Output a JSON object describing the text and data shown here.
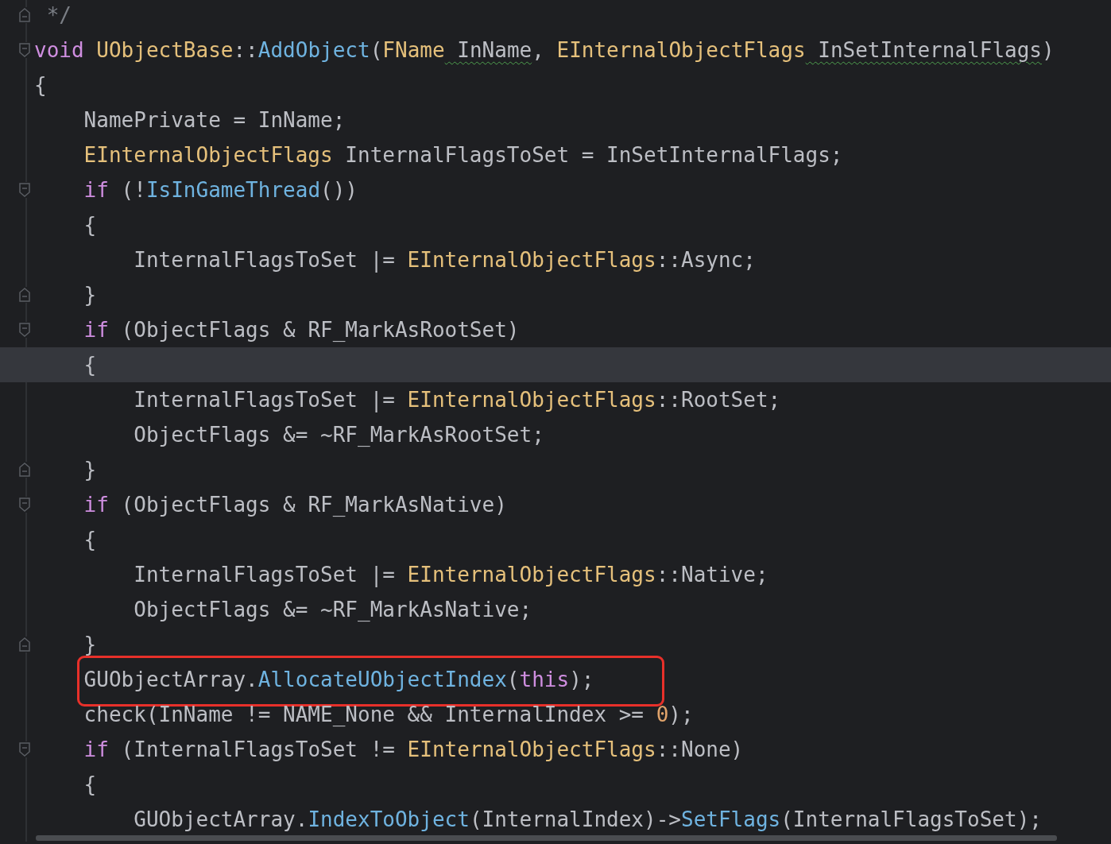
{
  "editor": {
    "lines": [
      {
        "kind": "fold_end",
        "current": false,
        "boxed": false,
        "tokens": [
          {
            "text": " */",
            "kind": "comment"
          }
        ]
      },
      {
        "kind": "fold_start",
        "current": false,
        "boxed": false,
        "tokens": [
          {
            "text": "void",
            "kind": "keyword"
          },
          {
            "text": " UObjectBase",
            "kind": "type"
          },
          {
            "text": "::",
            "kind": "plain"
          },
          {
            "text": "AddObject",
            "kind": "func"
          },
          {
            "text": "(",
            "kind": "plain"
          },
          {
            "text": "FName",
            "kind": "type"
          },
          {
            "text": " InName",
            "kind": "param_warn"
          },
          {
            "text": ", ",
            "kind": "plain"
          },
          {
            "text": "EInternalObjectFlags",
            "kind": "type"
          },
          {
            "text": " InSetInternalFlags",
            "kind": "param_warn"
          },
          {
            "text": ")",
            "kind": "plain"
          }
        ]
      },
      {
        "kind": "plain",
        "current": false,
        "boxed": false,
        "tokens": [
          {
            "text": "{",
            "kind": "plain"
          }
        ]
      },
      {
        "kind": "plain",
        "current": false,
        "boxed": false,
        "tokens": [
          {
            "text": "    NamePrivate = InName;",
            "kind": "plain"
          }
        ]
      },
      {
        "kind": "plain",
        "current": false,
        "boxed": false,
        "tokens": [
          {
            "text": "    EInternalObjectFlags",
            "kind": "type"
          },
          {
            "text": " InternalFlagsToSet = InSetInternalFlags;",
            "kind": "plain"
          }
        ]
      },
      {
        "kind": "fold_start",
        "current": false,
        "boxed": false,
        "tokens": [
          {
            "text": "    if",
            "kind": "keyword"
          },
          {
            "text": " (!",
            "kind": "plain"
          },
          {
            "text": "IsInGameThread",
            "kind": "func"
          },
          {
            "text": "())",
            "kind": "plain"
          }
        ]
      },
      {
        "kind": "plain",
        "current": false,
        "boxed": false,
        "tokens": [
          {
            "text": "    {",
            "kind": "plain"
          }
        ]
      },
      {
        "kind": "plain",
        "current": false,
        "boxed": false,
        "tokens": [
          {
            "text": "        InternalFlagsToSet |= ",
            "kind": "plain"
          },
          {
            "text": "EInternalObjectFlags",
            "kind": "type"
          },
          {
            "text": "::Async;",
            "kind": "plain"
          }
        ]
      },
      {
        "kind": "fold_end",
        "current": false,
        "boxed": false,
        "tokens": [
          {
            "text": "    }",
            "kind": "plain"
          }
        ]
      },
      {
        "kind": "fold_start",
        "current": false,
        "boxed": false,
        "tokens": [
          {
            "text": "    if",
            "kind": "keyword"
          },
          {
            "text": " (ObjectFlags & RF_MarkAsRootSet)",
            "kind": "plain"
          }
        ]
      },
      {
        "kind": "plain",
        "current": true,
        "boxed": false,
        "tokens": [
          {
            "text": "    {",
            "kind": "plain"
          }
        ]
      },
      {
        "kind": "plain",
        "current": false,
        "boxed": false,
        "tokens": [
          {
            "text": "        InternalFlagsToSet |= ",
            "kind": "plain"
          },
          {
            "text": "EInternalObjectFlags",
            "kind": "type"
          },
          {
            "text": "::RootSet;",
            "kind": "plain"
          }
        ]
      },
      {
        "kind": "plain",
        "current": false,
        "boxed": false,
        "tokens": [
          {
            "text": "        ObjectFlags &= ~RF_MarkAsRootSet;",
            "kind": "plain"
          }
        ]
      },
      {
        "kind": "fold_end",
        "current": false,
        "boxed": false,
        "tokens": [
          {
            "text": "    }",
            "kind": "plain"
          }
        ]
      },
      {
        "kind": "fold_start",
        "current": false,
        "boxed": false,
        "tokens": [
          {
            "text": "    if",
            "kind": "keyword"
          },
          {
            "text": " (ObjectFlags & RF_MarkAsNative)",
            "kind": "plain"
          }
        ]
      },
      {
        "kind": "plain",
        "current": false,
        "boxed": false,
        "tokens": [
          {
            "text": "    {",
            "kind": "plain"
          }
        ]
      },
      {
        "kind": "plain",
        "current": false,
        "boxed": false,
        "tokens": [
          {
            "text": "        InternalFlagsToSet |= ",
            "kind": "plain"
          },
          {
            "text": "EInternalObjectFlags",
            "kind": "type"
          },
          {
            "text": "::Native;",
            "kind": "plain"
          }
        ]
      },
      {
        "kind": "plain",
        "current": false,
        "boxed": false,
        "tokens": [
          {
            "text": "        ObjectFlags &= ~RF_MarkAsNative;",
            "kind": "plain"
          }
        ]
      },
      {
        "kind": "fold_end",
        "current": false,
        "boxed": false,
        "tokens": [
          {
            "text": "    }",
            "kind": "plain"
          }
        ]
      },
      {
        "kind": "plain",
        "current": false,
        "boxed": true,
        "tokens": [
          {
            "text": "    GUObjectArray.",
            "kind": "plain"
          },
          {
            "text": "AllocateUObjectIndex",
            "kind": "func"
          },
          {
            "text": "(",
            "kind": "plain"
          },
          {
            "text": "this",
            "kind": "keyword"
          },
          {
            "text": ");",
            "kind": "plain"
          }
        ]
      },
      {
        "kind": "plain",
        "current": false,
        "boxed": false,
        "tokens": [
          {
            "text": "    check(InName != NAME_None && InternalIndex >= ",
            "kind": "plain"
          },
          {
            "text": "0",
            "kind": "number"
          },
          {
            "text": ");",
            "kind": "plain"
          }
        ]
      },
      {
        "kind": "fold_start",
        "current": false,
        "boxed": false,
        "tokens": [
          {
            "text": "    if",
            "kind": "keyword"
          },
          {
            "text": " (InternalFlagsToSet != ",
            "kind": "plain"
          },
          {
            "text": "EInternalObjectFlags",
            "kind": "type"
          },
          {
            "text": "::None)",
            "kind": "plain"
          }
        ]
      },
      {
        "kind": "plain",
        "current": false,
        "boxed": false,
        "tokens": [
          {
            "text": "    {",
            "kind": "plain"
          }
        ]
      },
      {
        "kind": "plain",
        "current": false,
        "boxed": false,
        "tokens": [
          {
            "text": "        GUObjectArray.",
            "kind": "plain"
          },
          {
            "text": "IndexToObject",
            "kind": "func"
          },
          {
            "text": "(InternalIndex)->",
            "kind": "plain"
          },
          {
            "text": "SetFlags",
            "kind": "func"
          },
          {
            "text": "(InternalFlagsToSet);",
            "kind": "plain"
          }
        ]
      }
    ]
  }
}
